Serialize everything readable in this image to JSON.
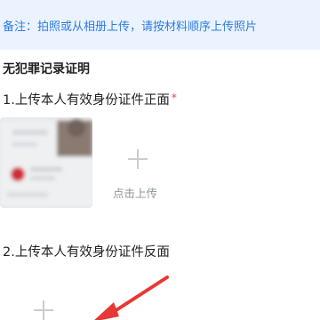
{
  "notice": {
    "text": "备注：拍照或从相册上传，请按材料顺序上传照片"
  },
  "section": {
    "title": "无犯罪记录证明"
  },
  "items": [
    {
      "label": "1.上传本人有效身份证件正面",
      "required_mark": "*",
      "upload_text": "点击上传"
    },
    {
      "label": "2.上传本人有效身份证件反面"
    }
  ],
  "icons": {
    "plus": "plus-icon",
    "arrow": "red-arrow-annotation"
  },
  "colors": {
    "notice_bg": "#eaf3ff",
    "notice_text": "#2f7de1",
    "required": "#e64340",
    "arrow": "#e53935"
  }
}
